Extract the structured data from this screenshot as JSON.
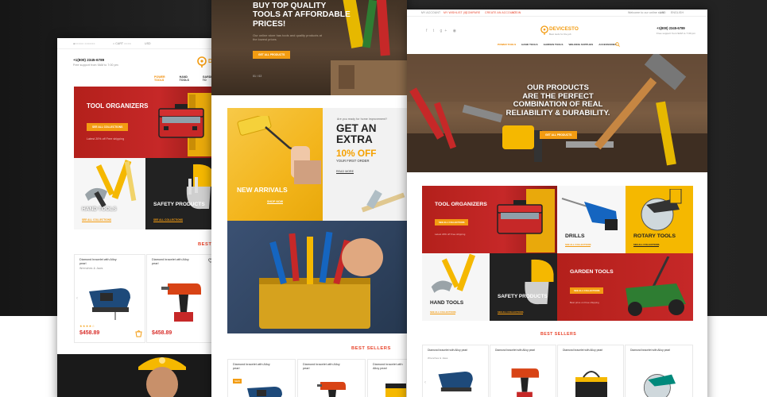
{
  "brand": {
    "name": "DEVICESTO",
    "tagline": "Best tools for the job"
  },
  "colors": {
    "accent": "#f39c12",
    "red": "#e8442b",
    "dark_red": "#b71c1c",
    "yellow": "#f5b800"
  },
  "left_page": {
    "phone": "+1(800) 2345-6789",
    "phone_note": "Free support from 9AM to 7:00 pm",
    "logo_partial": "DE",
    "nav": [
      "POWER TOOLS",
      "HAND TOOLS",
      "GARDEN TO"
    ],
    "tiles": {
      "organizers": {
        "title": "TOOL ORGANIZERS",
        "button": "SEE ALL COLLECTIONS",
        "note": "Latest 20% off Free shipping"
      },
      "hand_tools": {
        "title": "HAND TOOLS",
        "link": "SEE ALL COLLECTIONS"
      },
      "safety": {
        "title": "SAFETY PRODUCTS",
        "link": "SEE ALL COLLECTIONS"
      }
    },
    "section_title": "BEST",
    "products": [
      {
        "name": "Diamond bracelet with Alloy pearl",
        "sub": "Wrenches & Jaws",
        "price": "$458.89"
      },
      {
        "name": "Diamond bracelet with Alloy pearl",
        "sub": "",
        "price": "$458.89"
      }
    ]
  },
  "middle_page": {
    "hero": {
      "line1": "BUY TOP QUALITY",
      "line2": "TOOLS AT AFFORDABLE",
      "line3": "PRICES!",
      "sub": "Our online store has tools and quality products at the lowest prices",
      "button": "GET ALL PRODUCTS",
      "pager": "01 / 02"
    },
    "new_arrivals": {
      "title": "NEW ARRIVALS",
      "button": "SHOP NOW"
    },
    "promo": {
      "small": "Are you ready for home improvement?",
      "get": "GET AN",
      "extra": "EXTRA",
      "pct": "10% OFF",
      "first": "YOUR FIRST ORDER",
      "more": "READ MORE"
    },
    "section_title": "BEST SELLERS",
    "products": [
      {
        "name": "Diamond bracelet with Alloy pearl"
      },
      {
        "name": "Diamond bracelet with Alloy pearl"
      },
      {
        "name": "Diamond bracelet with Alloy pearl"
      }
    ],
    "new_badge": "NEW"
  },
  "right_page": {
    "top_links": [
      "MY ACCOUNT",
      "MY WISHLIST (0)",
      "COMPARE",
      "CREATE AN ACCOUNT",
      "LOGIN"
    ],
    "top_right": [
      "Welcome to our online store",
      "USD",
      "ENGLISH"
    ],
    "phone": "+1(800) 2345-6789",
    "phone_note": "Free support from 9AM to 7:00 pm",
    "nav": [
      "POWER TOOLS",
      "HAND TOOLS",
      "GARDEN TOOLS",
      "WELDING SUPPLIES",
      "ACCESSORIES"
    ],
    "hero": {
      "l1": "OUR PRODUCTS",
      "l2": "ARE THE PERFECT",
      "l3": "COMBINATION OF REAL",
      "l4": "RELIABILITY & DURABILITY.",
      "button": "GET ALL PRODUCTS"
    },
    "tiles": {
      "organizers": {
        "title": "TOOL ORGANIZERS",
        "button": "SEE ALL COLLECTIONS",
        "note": "Latest 20% off Free shipping"
      },
      "drills": {
        "title": "DRILLS",
        "link": "SEE ALL COLLECTIONS"
      },
      "rotary": {
        "title": "ROTARY TOOLS",
        "link": "SEE ALL COLLECTIONS"
      },
      "hand_tools": {
        "title": "HAND TOOLS",
        "link": "SEE ALL COLLECTIONS"
      },
      "safety": {
        "title": "SAFETY PRODUCTS",
        "link": "SEE ALL COLLECTIONS"
      },
      "garden": {
        "title": "GARDEN TOOLS",
        "button": "SEE ALL COLLECTIONS",
        "note": "Best price on Free shipping"
      }
    },
    "section_title": "BEST SELLERS",
    "products": [
      {
        "name": "Diamond bracelet with Alloy pearl",
        "sub": "Wrenches & Jaws"
      },
      {
        "name": "Diamond bracelet with Alloy pearl",
        "sub": ""
      },
      {
        "name": "Diamond bracelet with Alloy pearl",
        "sub": ""
      },
      {
        "name": "Diamond bracelet with Alloy pearl",
        "sub": ""
      }
    ]
  }
}
